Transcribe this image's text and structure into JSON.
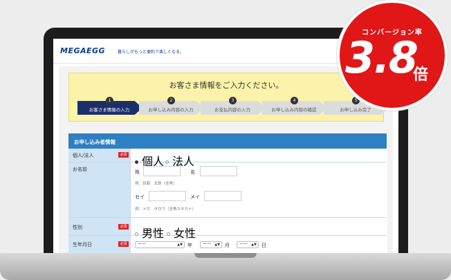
{
  "header": {
    "logo_prefix": "MEGA",
    "logo_egg": "EGG",
    "tagline": "暮らしがもっと便利で楽しくなる。"
  },
  "hero": {
    "title": "お客さま情報をご入力ください。",
    "steps": [
      {
        "num": "1",
        "label": "お客さま情報の入力",
        "active": true
      },
      {
        "num": "2",
        "label": "お申し込み内容の入力",
        "active": false
      },
      {
        "num": "3",
        "label": "お支払内容の入力",
        "active": false
      },
      {
        "num": "4",
        "label": "お申し込み内容の確認",
        "active": false
      },
      {
        "num": "5",
        "label": "お申し込み完了",
        "active": false
      }
    ]
  },
  "form": {
    "section_title": "お申し込み者情報",
    "required_label": "必須",
    "type_label": "個人/法人",
    "type_options": [
      "個人",
      "法人"
    ],
    "type_selected": "個人",
    "name_label": "お名前",
    "sei_label": "姓",
    "mei_label": "名",
    "name_hint": "例：目面　太郎（全角）",
    "sei_kana_label": "セイ",
    "mei_kana_label": "メイ",
    "kana_hint": "例：メガ　タロウ（全角カタカナ）",
    "gender_label": "性別",
    "gender_options": [
      "男性",
      "女性"
    ],
    "birth_label": "生年月日",
    "birth_year_value": "ーー",
    "birth_month_value": "ーー",
    "birth_day_value": "ーー",
    "year_unit": "年",
    "month_unit": "月",
    "day_unit": "日"
  },
  "badge": {
    "caption": "コンバージョン率",
    "value": "3.8",
    "unit": "倍"
  },
  "colors": {
    "brand_blue": "#0b3d8c",
    "form_header": "#2f7fc3",
    "active_step": "#1d2f6b",
    "badge_red": "#e01617",
    "hero_yellow": "#fbf3a9"
  }
}
